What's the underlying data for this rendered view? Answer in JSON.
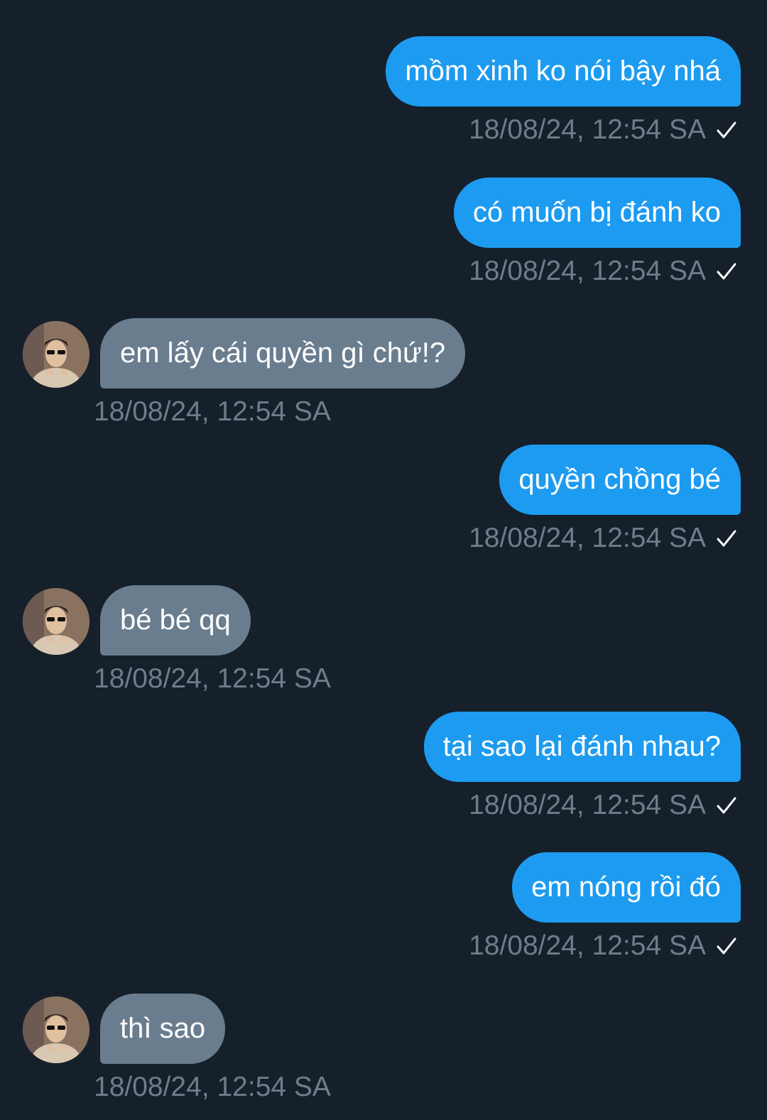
{
  "messages": [
    {
      "direction": "out",
      "text": "mồm xinh ko nói bậy nhá",
      "time": "18/08/24, 12:54 SA",
      "read_receipt": "check-icon"
    },
    {
      "direction": "out",
      "text": "có muốn bị đánh ko",
      "time": "18/08/24, 12:54 SA",
      "read_receipt": "check-icon"
    },
    {
      "direction": "in",
      "text": "em lấy cái quyền gì chứ!?",
      "time": "18/08/24, 12:54 SA"
    },
    {
      "direction": "out",
      "text": "quyền chồng bé",
      "time": "18/08/24, 12:54 SA",
      "read_receipt": "check-icon"
    },
    {
      "direction": "in",
      "text": "bé bé qq",
      "time": "18/08/24, 12:54 SA"
    },
    {
      "direction": "out",
      "text": "tại sao lại đánh nhau?",
      "time": "18/08/24, 12:54 SA",
      "read_receipt": "check-icon"
    },
    {
      "direction": "out",
      "text": "em nóng rồi đó",
      "time": "18/08/24, 12:54 SA",
      "read_receipt": "check-icon"
    },
    {
      "direction": "in",
      "text": "thì sao",
      "time": "18/08/24, 12:54 SA"
    }
  ],
  "colors": {
    "background": "#15202b",
    "outgoing_bubble": "#1d9bf0",
    "incoming_bubble": "#6a7d8f",
    "timestamp": "#6e7d8c"
  }
}
